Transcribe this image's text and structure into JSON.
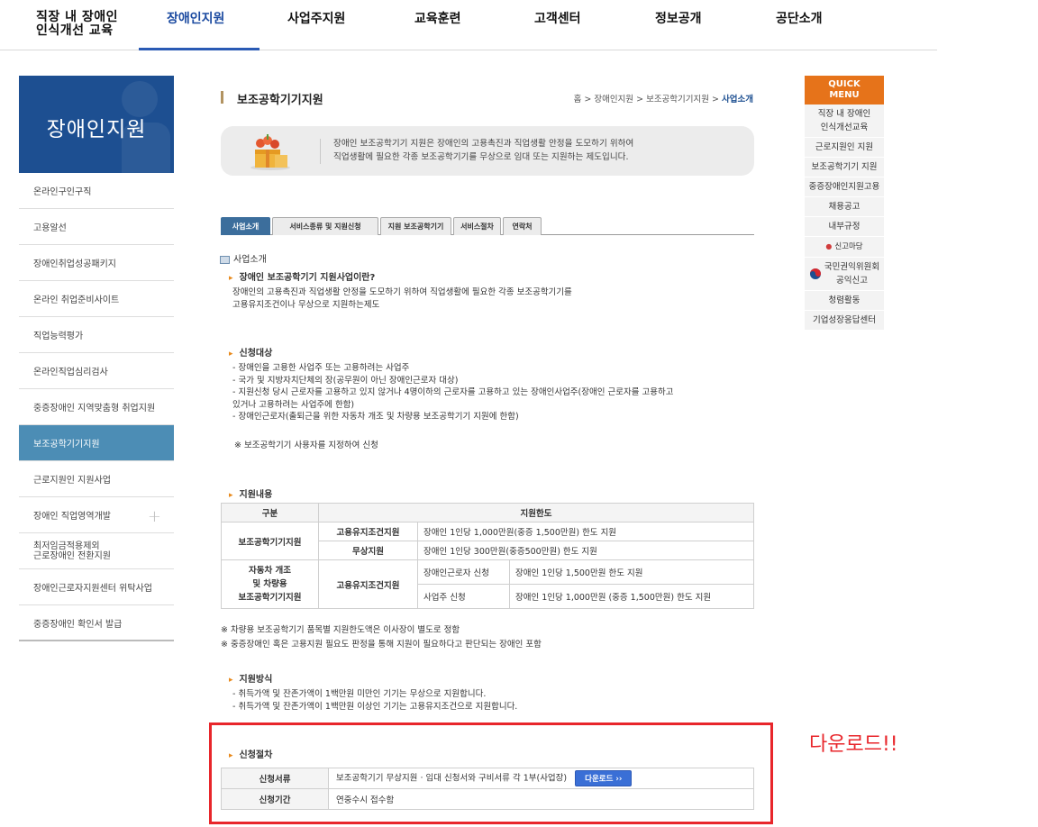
{
  "top_nav": {
    "brand_line1": "직장 내 장애인",
    "brand_line2": "인식개선 교육",
    "menu": [
      "장애인지원",
      "사업주지원",
      "교육훈련",
      "고객센터",
      "정보공개",
      "공단소개"
    ]
  },
  "lnb": {
    "title": "장애인지원",
    "items": [
      "온라인구인구직",
      "고용알선",
      "장애인취업성공패키지",
      "온라인 취업준비사이트",
      "직업능력평가",
      "온라인직업심리검사",
      "중증장애인 지역맞춤형 취업지원",
      "보조공학기기지원",
      "근로지원인 지원사업",
      "장애인 직업영역개발",
      "최저임금적용제외 근로장애인 전환지원",
      "장애인근로자지원센터 위탁사업",
      "중증장애인 확인서 발급"
    ],
    "item_11_line1": "최저임금적용제외",
    "item_11_line2": "근로장애인 전환지원",
    "expand_symbol": "+"
  },
  "page": {
    "title": "보조공학기기지원",
    "breadcrumb": [
      "홈",
      "장애인지원",
      "보조공학기기지원",
      "사업소개"
    ],
    "breadcrumb_sep": ">",
    "intro_line1": "장애인 보조공학기기 지원은 장애인의 고용촉진과 직업생활 안정을 도모하기 위하여",
    "intro_line2": "직업생활에 필요한 각종 보조공학기기를 무상으로 임대 또는 지원하는 제도입니다."
  },
  "tabs": [
    "사업소개",
    "서비스종류 및 지원신청",
    "지원 보조공학기기",
    "서비스절차",
    "연락처"
  ],
  "content": {
    "section_title": "사업소개",
    "s1_title": "장애인 보조공학기기 지원사업이란?",
    "s1_line1": "장애인의 고용촉진과 직업생활 안정을 도모하기 위하여 직업생활에 필요한 각종 보조공학기기를",
    "s1_line2": "고용유지조건이나 무상으로 지원하는제도",
    "s2_title": "신청대상",
    "s2_line1": "- 장애인을 고용한 사업주 또는 고용하려는 사업주",
    "s2_line2": "- 국가 및 지방자치단체의 장(공무원이 아닌 장애인근로자 대상)",
    "s2_line3": "- 지원신청 당시 근로자를 고용하고 있지 않거나 4명이하의 근로자를 고용하고 있는 장애인사업주(장애인 근로자를 고용하고",
    "s2_line4": "있거나 고용하려는 사업주에 한함)",
    "s2_line5": "- 장애인근로자(출퇴근을 위한 자동차 개조 및 차량용 보조공학기기 지원에 한함)",
    "s2_note": "※ 보조공학기기 사용자를 지정하여 신청",
    "s3_title": "지원내용",
    "table": {
      "h_col1": "구분",
      "h_col2": "지원한도",
      "r1_cat": "보조공학기기지원",
      "r1a_type": "고용유지조건지원",
      "r1a_limit": "장애인 1인당 1,000만원(중증 1,500만원) 한도 지원",
      "r1b_type": "무상지원",
      "r1b_limit": "장애인 1인당 300만원(중증500만원) 한도 지원",
      "r2_cat_1": "자동차 개조",
      "r2_cat_2": "및 차량용",
      "r2_cat_3": "보조공학기기지원",
      "r2_type": "고용유지조건지원",
      "r2a_who": "장애인근로자 신청",
      "r2a_limit": "장애인 1인당 1,500만원 한도 지원",
      "r2b_who": "사업주 신청",
      "r2b_limit": "장애인 1인당 1,000만원 (중증 1,500만원) 한도 지원"
    },
    "s3_note1": "※ 차량용 보조공학기기 품목별 지원한도액은 이사장이 별도로 정함",
    "s3_note2": "※ 중증장애인 혹은 고용지원 필요도 판정을 통해 지원이 필요하다고 판단되는 장애인 포함",
    "s4_title": "지원방식",
    "s4_line1": "- 취득가액 및 잔존가액이 1백만원 미만인 기기는 무상으로 지원합니다.",
    "s4_line2": "- 취득가액 및 잔존가액이 1백만원 이상인 기기는 고용유지조건으로 지원합니다.",
    "s5_title": "신청절차",
    "s5_docs_label": "신청서류",
    "s5_docs_value": "보조공학기기 무상지원 · 임대 신청서와 구비서류 각 1부(사업장)",
    "s5_download": "다운로드 ››",
    "s5_period_label": "신청기간",
    "s5_period_value": "연중수시 접수함"
  },
  "annotation": {
    "label": "다운로드!!",
    "color": "#e8262b"
  },
  "quick_menu": {
    "title_1": "QUICK",
    "title_2": "MENU",
    "items": [
      "직장 내 장애인 인식개선교육",
      "근로지원인 지원",
      "보조공학기기 지원",
      "중증장애인지원고용",
      "채용공고",
      "내부규정",
      "신고마당",
      "국민권익위원회 공익신고",
      "청렴활동",
      "기업성장응답센터"
    ],
    "item_0_line1": "직장 내 장애인",
    "item_0_line2": "인식개선교육",
    "item_7_line1": "국민권익위원회",
    "item_7_line2": "공익신고"
  },
  "colors": {
    "brand_blue": "#1d4f91",
    "active_lnb": "#4c8db5",
    "quick_orange": "#e6731a",
    "bullet_orange": "#e8891b"
  }
}
